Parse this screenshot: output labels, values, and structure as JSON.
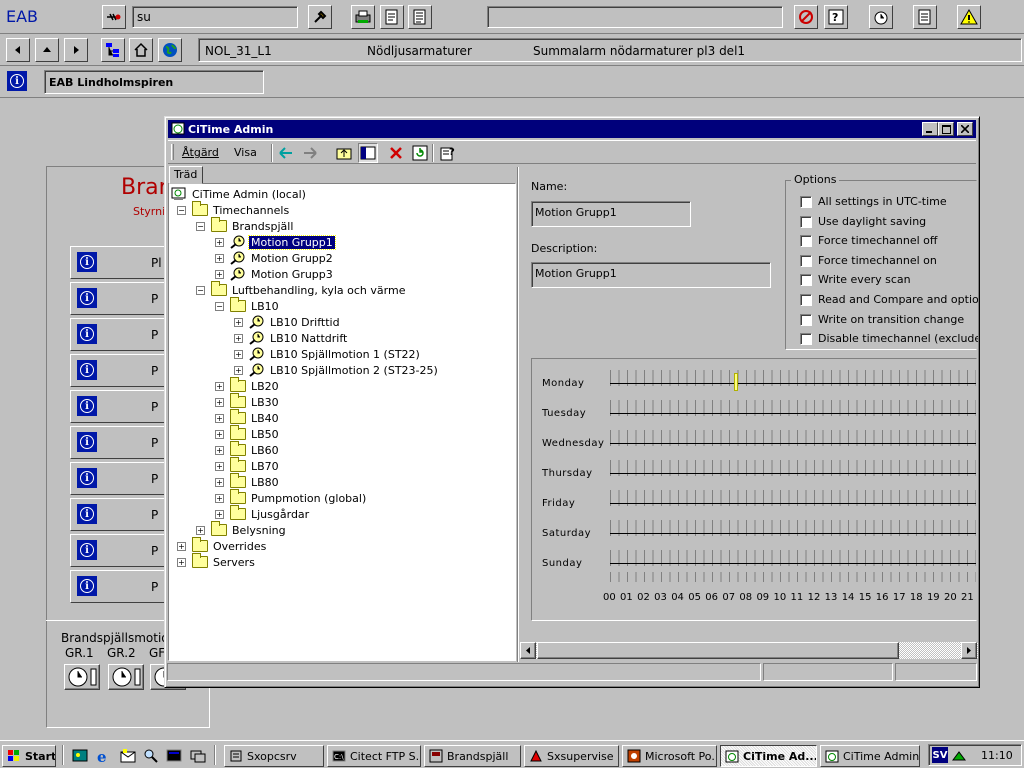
{
  "top_bar": {
    "app_label": "EAB",
    "search_value": "su",
    "location_code": "NOL_31_L1",
    "location_name": "Nödljusarmaturer",
    "location_desc": "Summalarm nödarmaturer pl3 del1",
    "site_name": "EAB Lindholmspiren"
  },
  "background_panel": {
    "title": "Bran",
    "subtitle": "Styrni",
    "button_labels": [
      "Pl",
      "P",
      "P",
      "P",
      "P",
      "P",
      "P",
      "P",
      "P",
      "P"
    ],
    "footer_title": "Brandspjällsmotio",
    "groups": [
      "GR.1",
      "GR.2",
      "GF"
    ]
  },
  "window": {
    "title": "CiTime Admin",
    "menu": [
      "Åtgärd",
      "Visa"
    ],
    "tab_label": "Träd",
    "tree": [
      {
        "label": "CiTime Admin (local)",
        "level": 0,
        "icon": "computer-icon",
        "expander": ""
      },
      {
        "label": "Timechannels",
        "level": 1,
        "icon": "folder-icon",
        "expander": "−"
      },
      {
        "label": "Brandspjäll",
        "level": 2,
        "icon": "folder-icon",
        "expander": "−"
      },
      {
        "label": "Motion Grupp1",
        "level": 3,
        "icon": "clock-channel-icon",
        "expander": "+",
        "selected": true
      },
      {
        "label": "Motion Grupp2",
        "level": 3,
        "icon": "clock-channel-icon",
        "expander": "+"
      },
      {
        "label": "Motion Grupp3",
        "level": 3,
        "icon": "clock-channel-icon",
        "expander": "+"
      },
      {
        "label": "Luftbehandling, kyla och värme",
        "level": 2,
        "icon": "folder-icon",
        "expander": "−"
      },
      {
        "label": "LB10",
        "level": 3,
        "icon": "folder-icon",
        "expander": "−"
      },
      {
        "label": "LB10 Drifttid",
        "level": 4,
        "icon": "clock-channel-icon",
        "expander": "+"
      },
      {
        "label": "LB10 Nattdrift",
        "level": 4,
        "icon": "clock-channel-icon",
        "expander": "+"
      },
      {
        "label": "LB10 Spjällmotion 1 (ST22)",
        "level": 4,
        "icon": "clock-channel-icon",
        "expander": "+"
      },
      {
        "label": "LB10 Spjällmotion 2 (ST23-25)",
        "level": 4,
        "icon": "clock-channel-icon",
        "expander": "+"
      },
      {
        "label": "LB20",
        "level": 3,
        "icon": "folder-icon",
        "expander": "+"
      },
      {
        "label": "LB30",
        "level": 3,
        "icon": "folder-icon",
        "expander": "+"
      },
      {
        "label": "LB40",
        "level": 3,
        "icon": "folder-icon",
        "expander": "+"
      },
      {
        "label": "LB50",
        "level": 3,
        "icon": "folder-icon",
        "expander": "+"
      },
      {
        "label": "LB60",
        "level": 3,
        "icon": "folder-icon",
        "expander": "+"
      },
      {
        "label": "LB70",
        "level": 3,
        "icon": "folder-icon",
        "expander": "+"
      },
      {
        "label": "LB80",
        "level": 3,
        "icon": "folder-icon",
        "expander": "+"
      },
      {
        "label": "Pumpmotion (global)",
        "level": 3,
        "icon": "folder-icon",
        "expander": "+"
      },
      {
        "label": "Ljusgårdar",
        "level": 3,
        "icon": "folder-icon",
        "expander": "+"
      },
      {
        "label": "Belysning",
        "level": 2,
        "icon": "folder-icon",
        "expander": "+"
      },
      {
        "label": "Overrides",
        "level": 1,
        "icon": "folder-icon",
        "expander": "+"
      },
      {
        "label": "Servers",
        "level": 1,
        "icon": "folder-icon",
        "expander": "+"
      }
    ],
    "details": {
      "name_label": "Name:",
      "name_value": "Motion Grupp1",
      "description_label": "Description:",
      "description_value": "Motion Grupp1"
    },
    "options": {
      "title": "Options",
      "items": [
        "All settings in UTC-time",
        "Use daylight saving",
        "Force timechannel off",
        "Force timechannel on",
        "Write every scan",
        "Read and Compare and optionally",
        "Write on transition change",
        "Disable timechannel (exclude from"
      ]
    },
    "schedule": {
      "days": [
        "Monday",
        "Tuesday",
        "Wednesday",
        "Thursday",
        "Friday",
        "Saturday",
        "Sunday"
      ],
      "hours": [
        "00",
        "01",
        "02",
        "03",
        "04",
        "05",
        "06",
        "07",
        "08",
        "09",
        "10",
        "11",
        "12",
        "13",
        "14",
        "15",
        "16",
        "17",
        "18",
        "19",
        "20",
        "21"
      ],
      "marker_day": "Monday",
      "marker_hour": 7.3
    }
  },
  "taskbar": {
    "start_label": "Start",
    "tasks": [
      "Sxopcsrv",
      "Citect FTP S...",
      "Brandspjäll",
      "Sxsupervise",
      "Microsoft Po...",
      "CiTime Ad...",
      "CiTime Admin"
    ],
    "active_task": "CiTime Ad...",
    "lang": "SV",
    "clock": "11:10"
  },
  "colors": {
    "desktop": "#c0c0c0",
    "title_active": "#00007b",
    "brand_red": "#b00000",
    "info_blue": "#0018a8",
    "marker": "#ffff80"
  }
}
